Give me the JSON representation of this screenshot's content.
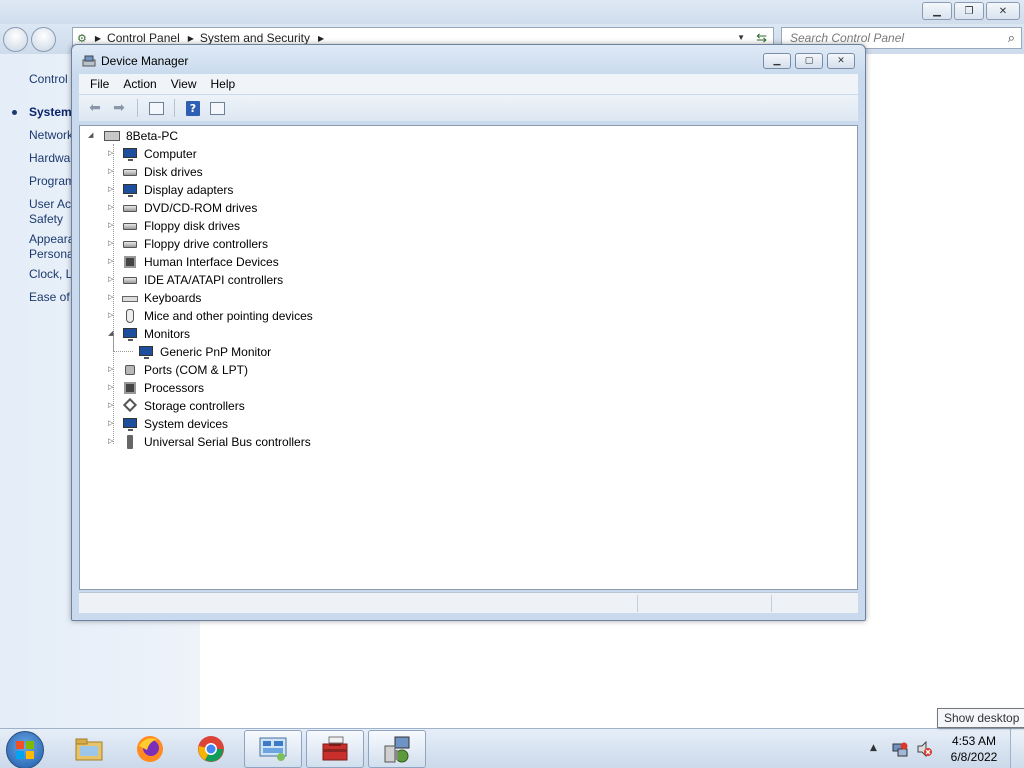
{
  "control_panel": {
    "breadcrumb": [
      "Control Panel",
      "System and Security"
    ],
    "search_placeholder": "Search Control Panel",
    "sidebar": [
      {
        "label": "Control",
        "active": false
      },
      {
        "label": "System",
        "active": true
      },
      {
        "label": "Network",
        "active": false
      },
      {
        "label": "Hardwa",
        "active": false
      },
      {
        "label": "Program",
        "active": false
      },
      {
        "label": "User Acc",
        "active": false
      },
      {
        "label": "Safety",
        "active": false
      },
      {
        "label": "Appeara",
        "active": false
      },
      {
        "label": "Persona",
        "active": false
      },
      {
        "label": "Clock, L",
        "active": false
      },
      {
        "label": "Ease of A",
        "active": false
      }
    ]
  },
  "device_manager": {
    "title": "Device Manager",
    "menu": [
      "File",
      "Action",
      "View",
      "Help"
    ],
    "toolbar": {
      "back": "back-arrow-icon",
      "forward": "forward-arrow-icon",
      "properties": "properties-icon",
      "help": "?",
      "show_hide": "show-hide-console-tree-icon"
    },
    "tree": {
      "root": "8Beta-PC",
      "categories": [
        {
          "label": "Computer",
          "icon": "computer-icon",
          "expanded": false
        },
        {
          "label": "Disk drives",
          "icon": "disk-drive-icon",
          "expanded": false
        },
        {
          "label": "Display adapters",
          "icon": "display-adapter-icon",
          "expanded": false
        },
        {
          "label": "DVD/CD-ROM drives",
          "icon": "dvd-drive-icon",
          "expanded": false
        },
        {
          "label": "Floppy disk drives",
          "icon": "floppy-disk-icon",
          "expanded": false
        },
        {
          "label": "Floppy drive controllers",
          "icon": "floppy-controller-icon",
          "expanded": false
        },
        {
          "label": "Human Interface Devices",
          "icon": "hid-icon",
          "expanded": false
        },
        {
          "label": "IDE ATA/ATAPI controllers",
          "icon": "ide-controller-icon",
          "expanded": false
        },
        {
          "label": "Keyboards",
          "icon": "keyboard-icon",
          "expanded": false
        },
        {
          "label": "Mice and other pointing devices",
          "icon": "mouse-icon",
          "expanded": false
        },
        {
          "label": "Monitors",
          "icon": "monitor-icon",
          "expanded": true,
          "children": [
            "Generic PnP Monitor"
          ]
        },
        {
          "label": "Ports (COM & LPT)",
          "icon": "port-icon",
          "expanded": false
        },
        {
          "label": "Processors",
          "icon": "processor-icon",
          "expanded": false
        },
        {
          "label": "Storage controllers",
          "icon": "storage-controller-icon",
          "expanded": false
        },
        {
          "label": "System devices",
          "icon": "system-device-icon",
          "expanded": false
        },
        {
          "label": "Universal Serial Bus controllers",
          "icon": "usb-icon",
          "expanded": false
        }
      ]
    }
  },
  "taskbar": {
    "items": [
      "windows-explorer-icon",
      "firefox-icon",
      "chrome-icon",
      "control-panel-icon",
      "toolbox-icon",
      "device-manager-icon"
    ],
    "clock_time": "4:53 AM",
    "clock_date": "6/8/2022",
    "tooltip": "Show desktop"
  },
  "colors": {
    "accent": "#1d4f9c",
    "window_frame": "#c9daee",
    "taskbar": "#cbd9ea"
  }
}
